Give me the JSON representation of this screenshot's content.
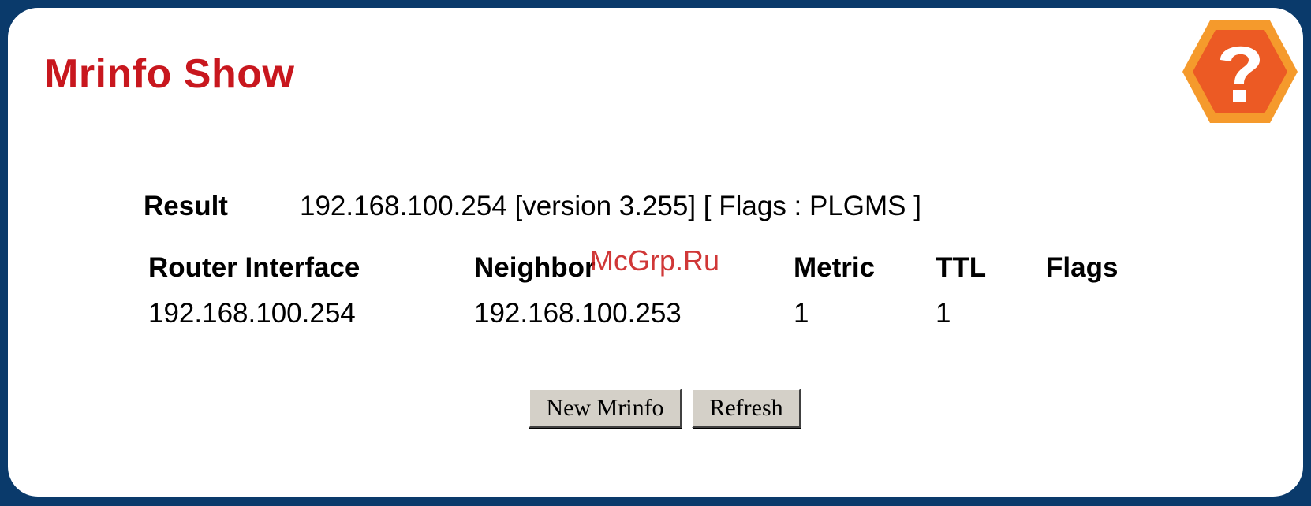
{
  "page": {
    "title": "Mrinfo Show",
    "help_icon": "help-question-icon"
  },
  "result": {
    "label": "Result",
    "value": "192.168.100.254 [version 3.255] [ Flags : PLGMS ]"
  },
  "table": {
    "columns": [
      "Router Interface",
      "Neighbor",
      "Metric",
      "TTL",
      "Flags"
    ],
    "rows": [
      [
        "192.168.100.254",
        "192.168.100.253",
        "1",
        "1",
        ""
      ]
    ]
  },
  "buttons": {
    "new_mrinfo": "New Mrinfo",
    "refresh": "Refresh"
  },
  "watermark": "McGrp.Ru",
  "colors": {
    "background": "#0a3a6b",
    "title": "#c8171e",
    "help_outer": "#f59a2c",
    "help_inner": "#ec5a24"
  }
}
